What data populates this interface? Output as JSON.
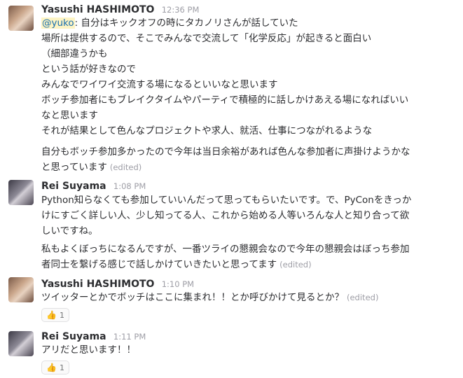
{
  "messages": [
    {
      "author": "Yasushi HASHIMOTO",
      "time": "12:36 PM",
      "mention": "@yuko",
      "lines": [
        ": 自分はキックオフの時にタカノリさんが話していた",
        "場所は提供するので、そこでみんなで交流して「化学反応」が起きると面白い",
        "（細部違うかも",
        "という話が好きなので",
        "みんなでワイワイ交流する場になるといいなと思います",
        "ボッチ参加者にもブレイクタイムやパーティで積極的に話しかけあえる場になればいい",
        "なと思います",
        "それが結果として色んなプロジェクトや求人、就活、仕事につながれるような"
      ],
      "extra_lines": [
        "自分もボッチ参加多かったので今年は当日余裕があれば色んな参加者に声掛けようかな",
        "と思っています"
      ],
      "edited": "(edited)"
    },
    {
      "author": "Rei Suyama",
      "time": "1:08 PM",
      "lines": [
        "Python知らなくても参加していいんだって思ってもらいたいです。で、PyConをきっか",
        "けにすごく詳しい人、少し知ってる人、これから始める人等いろんな人と知り合って欲",
        "しいですね。"
      ],
      "extra_lines": [
        "私もよくぼっちになるんですが、一番ツライの懇親会なので今年の懇親会はぼっち参加",
        "者同士を繋げる感じで話しかけていきたいと思ってます"
      ],
      "edited": "(edited)"
    },
    {
      "author": "Yasushi HASHIMOTO",
      "time": "1:10 PM",
      "lines": [
        "ツイッターとかでボッチはここに集まれ！！とか呼びかけて見るとか？"
      ],
      "edited": "(edited)",
      "reaction": {
        "emoji": "thumbs-up",
        "count": "1"
      }
    },
    {
      "author": "Rei Suyama",
      "time": "1:11 PM",
      "lines": [
        "アリだと思います！！"
      ],
      "reaction": {
        "emoji": "thumbs-up",
        "count": "1"
      }
    }
  ]
}
